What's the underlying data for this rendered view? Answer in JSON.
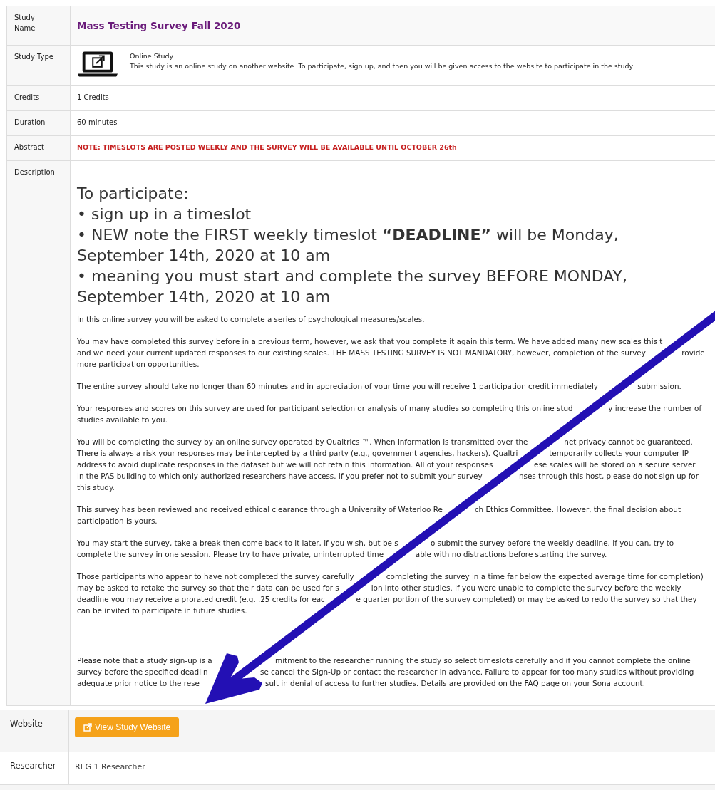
{
  "details": [
    {
      "label": "Study Name",
      "kind": "title",
      "value": "Mass Testing Survey Fall 2020"
    },
    {
      "label": "Study Type",
      "kind": "type",
      "type_name": "Online Study",
      "value": "This study is an online study on another website. To participate, sign up, and then you will be given access to the website to participate in the study."
    },
    {
      "label": "Credits",
      "kind": "text",
      "value": "1 Credits"
    },
    {
      "label": "Duration",
      "kind": "text",
      "value": "60 minutes"
    },
    {
      "label": "Abstract",
      "kind": "alert",
      "value": "NOTE: TIMESLOTS ARE POSTED WEEKLY AND THE SURVEY WILL BE AVAILABLE UNTIL OCTOBER 26th"
    },
    {
      "label": "Description",
      "kind": "description",
      "heading_lines": [
        "To participate:",
        "• sign up in a timeslot",
        "• NEW note the FIRST weekly timeslot **“DEADLINE”** will be Monday,",
        "September 14th, 2020 at 10 am",
        "• meaning you must start and complete the survey BEFORE MONDAY,",
        "September 14th, 2020 at 10 am"
      ],
      "paragraphs": [
        [
          [
            "In this online survey you will be asked to complete a series of psychological measures/scales."
          ]
        ],
        [
          [
            "You may have completed this survey before in a previous term, however, we ask that you complete it again this term. We have added many new scales this t"
          ],
          [
            "and we need your current updated responses to our existing scales. THE MASS TESTING SURVEY IS NOT MANDATORY, however, completion of the survey",
            "rovide"
          ],
          [
            "more participation opportunities."
          ]
        ],
        [
          [
            "The entire survey should take no longer than 60 minutes and in appreciation of your time you will receive 1 participation credit immediately",
            "submission."
          ]
        ],
        [
          [
            "Your responses and scores on this survey are used for participant selection or analysis of many studies so completing this online stud",
            "y increase the number of"
          ],
          [
            "studies available to you."
          ]
        ],
        [
          [
            "You will be completing the survey by an online survey operated by Qualtrics ™. When information is transmitted over the",
            "net privacy cannot be guaranteed."
          ],
          [
            "There is always a risk your responses may be intercepted by a third party (e.g., government agencies, hackers). Qualtri",
            "temporarily collects your computer IP"
          ],
          [
            "address to avoid duplicate responses in the dataset but we will not retain this information. All of your responses",
            "ese scales will be stored on a secure server"
          ],
          [
            "in the PAS building to which only authorized researchers have access. If you prefer not to submit your survey",
            "nses through this host, please do not sign up for"
          ],
          [
            "this study."
          ]
        ],
        [
          [
            "This survey has been reviewed and received ethical clearance through a University of Waterloo Re",
            "ch Ethics Committee. However, the final decision about"
          ],
          [
            "participation is yours."
          ]
        ],
        [
          [
            "You may start the survey, take a break then come back to it later, if you wish, but be s",
            "o submit the survey before the weekly deadline. If you can, try to"
          ],
          [
            "complete the survey in one session. Please try to have private, uninterrupted time",
            "able with no distractions before starting the survey."
          ]
        ],
        [
          [
            "Those participants who appear to have not completed the survey carefully",
            "completing the survey in a time far below the expected average time for completion)"
          ],
          [
            "may be asked to retake the survey so that their data can be used for s",
            "ion into other studies. If you were unable to complete the survey before the weekly"
          ],
          [
            "deadline you may receive a prorated credit (e.g. .25 credits for eac",
            "e quarter portion of the survey completed) or may be asked to redo the survey so that they"
          ],
          [
            "can be invited to participate in future studies."
          ]
        ]
      ],
      "note_lines": [
        [
          "Please note that a study sign-up is a",
          "mitment to the researcher running the study so select timeslots carefully and if you cannot complete the online"
        ],
        [
          "survey before the specified deadlin",
          "se cancel the Sign-Up or contact the researcher in advance. Failure to appear for too many studies without providing"
        ],
        [
          "adequate prior notice to the rese",
          "sult in denial of access to further studies. Details are provided on the FAQ page on your Sona account."
        ]
      ]
    }
  ],
  "lower_details": [
    {
      "label": "Website",
      "kind": "button",
      "value": "View Study Website"
    },
    {
      "label": "Researcher",
      "kind": "text",
      "value": "REG 1 Researcher"
    }
  ]
}
